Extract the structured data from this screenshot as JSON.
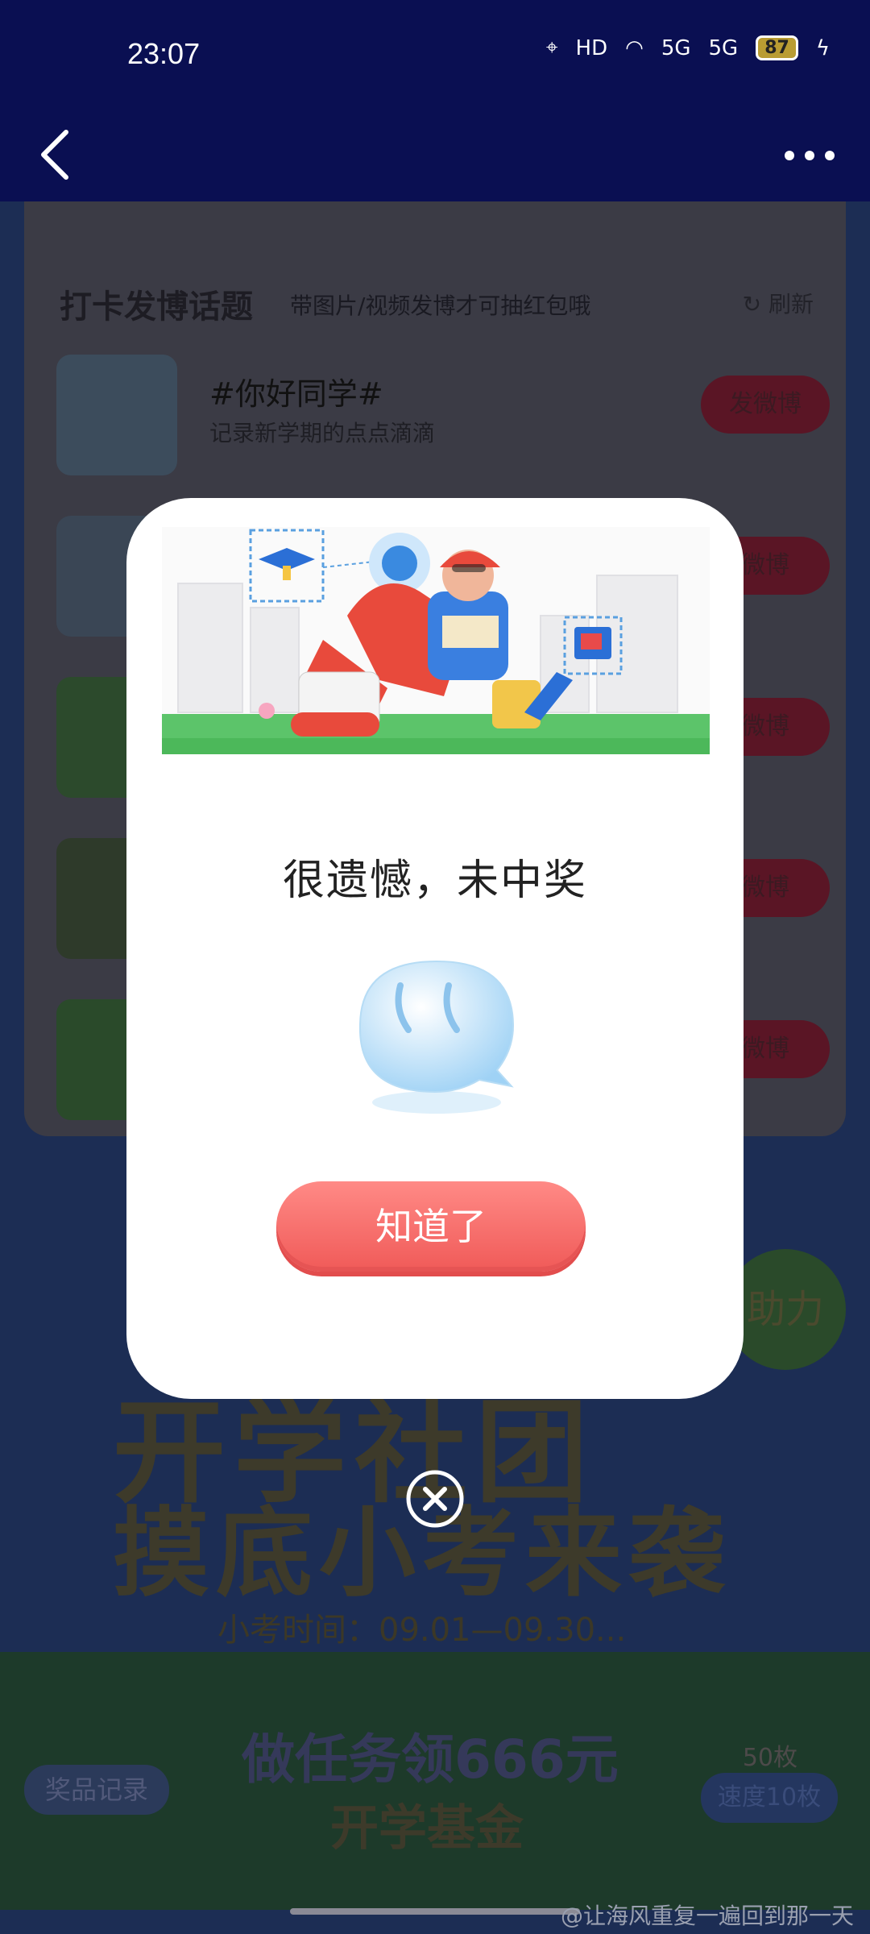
{
  "status": {
    "time": "23:07",
    "battery": "87",
    "network": "5G",
    "hd": "HD"
  },
  "nav": {
    "title": ""
  },
  "bg": {
    "days": [
      "",
      "",
      "",
      "",
      "",
      "",
      ""
    ],
    "topic_title": "打卡发博话题",
    "topic_sub": "带图片/视频发博才可抽红包哦",
    "refresh": "刷新",
    "rows": [
      {
        "title": "#你好同学#",
        "desc": "记录新学期的点点滴滴",
        "btn": "发微博"
      },
      {
        "title": "",
        "desc": "",
        "btn": "微博"
      },
      {
        "title": "",
        "desc": "",
        "btn": "微博"
      },
      {
        "title": "",
        "desc": "",
        "btn": "微博"
      },
      {
        "title": "",
        "desc": "",
        "btn": "微博"
      }
    ],
    "banner1": "开学社团",
    "banner2": "摸底小考来袭",
    "exam_time": "小考时间：09.01—09.30...",
    "help": "助力",
    "prize_record": "奖品记录",
    "task1": "做任务领666元",
    "task2": "开学基金",
    "count": "50枚",
    "speed": "速度10枚"
  },
  "modal": {
    "result": "很遗憾，未中奖",
    "ok": "知道了"
  },
  "watermark": "@让海风重复一遍回到那一天"
}
